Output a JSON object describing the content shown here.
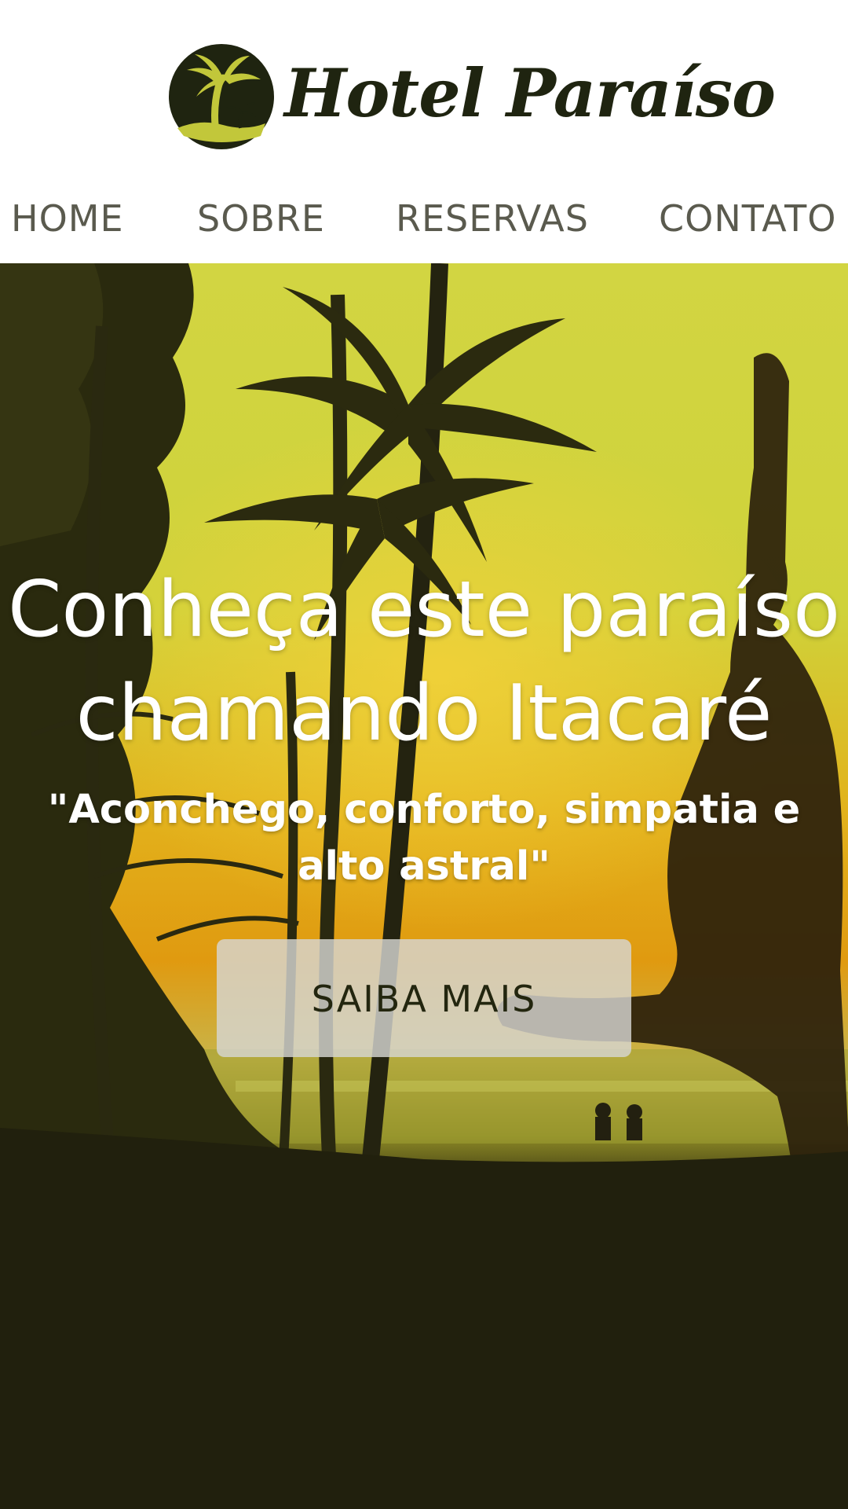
{
  "brand": {
    "name": "Hotel Paraíso",
    "logo_icon": "palm-tree-icon",
    "colors": {
      "logo_dark": "#1f2410",
      "logo_accent": "#c2c73a"
    }
  },
  "nav": {
    "items": [
      {
        "label": "HOME"
      },
      {
        "label": "SOBRE"
      },
      {
        "label": "RESERVAS"
      },
      {
        "label": "CONTATO"
      }
    ],
    "text_color": "#5a5a4e"
  },
  "hero": {
    "title": "Conheça este paraíso chamando Itacaré",
    "subtitle": "\"Aconchego, conforto, simpatia e alto astral\"",
    "cta_label": "SAIBA MAIS",
    "background": "sunset palm trees beach photo with person in yoga pose",
    "colors": {
      "sky": "#d6d23a",
      "sunset": "#e0a012",
      "dark_foliage": "#21200d",
      "text": "#ffffff",
      "button_bg": "#d6d6d2"
    }
  }
}
